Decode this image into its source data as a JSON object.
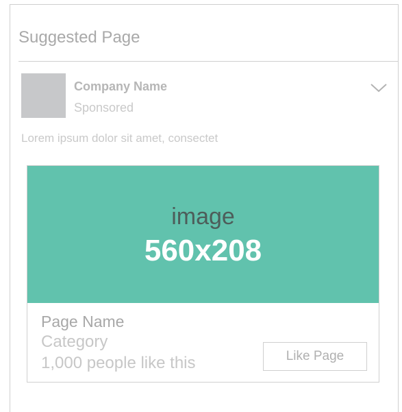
{
  "panel": {
    "title": "Suggested Page"
  },
  "post": {
    "company_name": "Company Name",
    "sponsored_label": "Sponsored",
    "menu_icon": "chevron-down-icon",
    "text": "Lorem ipsum dolor sit amet, consectet"
  },
  "card": {
    "image_word": "image",
    "image_size": "560x208",
    "page_name": "Page Name",
    "category": "Category",
    "likes": "1,000 people like this",
    "like_button_label": "Like Page"
  },
  "colors": {
    "image_placeholder": "#61c2ad",
    "avatar_placeholder": "#c7c8ca",
    "border": "#cfcfcf",
    "muted_text": "#c9c9c9"
  }
}
